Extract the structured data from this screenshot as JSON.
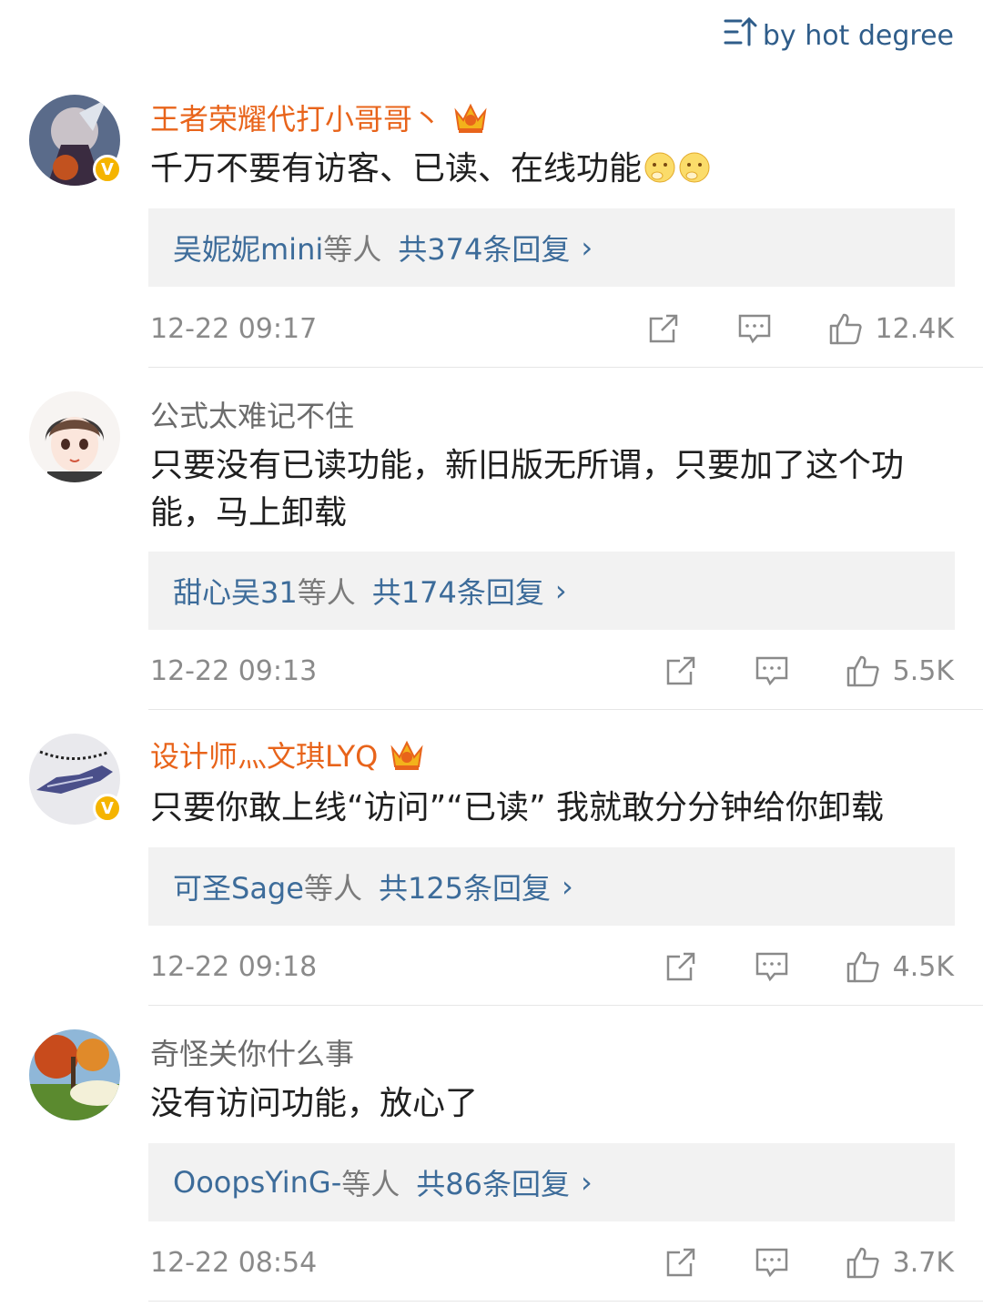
{
  "sort": {
    "label": "by hot degree"
  },
  "comments": [
    {
      "username": "王者荣耀代打小哥哥丶",
      "text": "千万不要有访客、已读、在线功能",
      "reply_users": "吴妮妮mini",
      "reply_suffix": "等人",
      "reply_count": "共374条回复",
      "time": "12-22 09:17",
      "likes": "12.4K"
    },
    {
      "username": "公式太难记不住",
      "text": "只要没有已读功能，新旧版无所谓，只要加了这个功能，马上卸载",
      "reply_users": "甜心吴31",
      "reply_suffix": "等人",
      "reply_count": "共174条回复",
      "time": "12-22 09:13",
      "likes": "5.5K"
    },
    {
      "username": "设计师灬文琪LYQ",
      "text": "只要你敢上线“访问”“已读” 我就敢分分钟给你卸载",
      "reply_users": "可圣Sage",
      "reply_suffix": "等人",
      "reply_count": "共125条回复",
      "time": "12-22 09:18",
      "likes": "4.5K"
    },
    {
      "username": "奇怪关你什么事",
      "text": "没有访问功能，放心了",
      "reply_users": "OoopsYinG-",
      "reply_suffix": "等人",
      "reply_count": "共86条回复",
      "time": "12-22 08:54",
      "likes": "3.7K"
    }
  ],
  "colors": {
    "vip_name": "#e8641b",
    "link": "#3d6c9a",
    "meta": "#8a8a8a",
    "badge": "#f5b400"
  },
  "icons": [
    "sort-icon",
    "crown-icon",
    "verified-icon",
    "repost-icon",
    "comment-icon",
    "like-icon",
    "chevron-right-icon",
    "shy-emoji-icon"
  ]
}
